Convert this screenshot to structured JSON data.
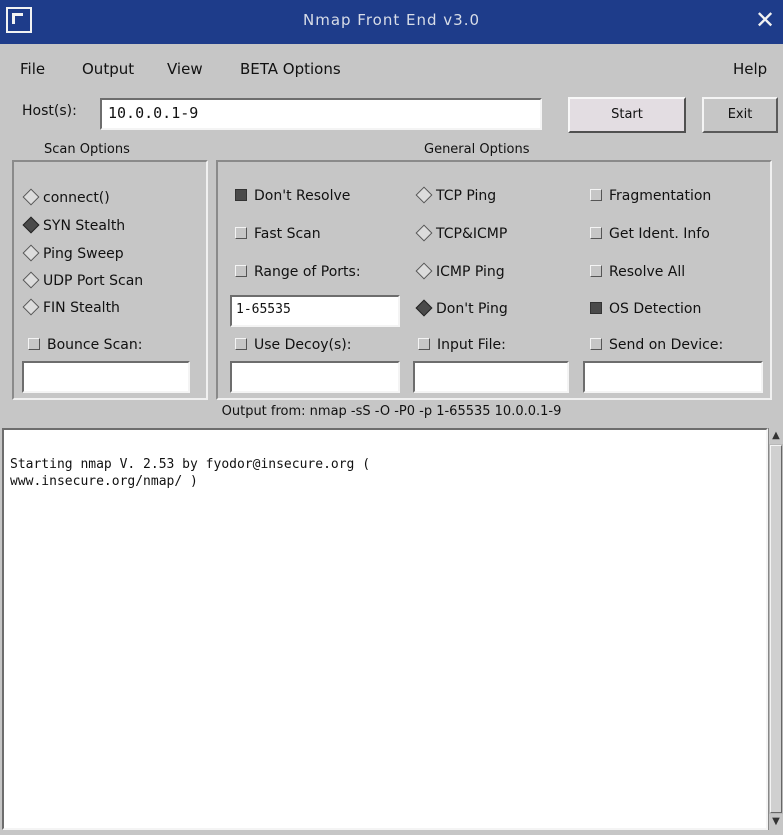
{
  "window": {
    "title": "Nmap Front End v3.0",
    "close_glyph": "✕"
  },
  "menubar": {
    "file": "File",
    "output": "Output",
    "view": "View",
    "beta": "BETA Options",
    "help": "Help"
  },
  "hosts": {
    "label": "Host(s):",
    "value": "10.0.0.1-9"
  },
  "buttons": {
    "start": "Start",
    "exit": "Exit"
  },
  "scan_options": {
    "title": "Scan Options",
    "connect": "connect()",
    "syn": "SYN Stealth",
    "ping_sweep": "Ping Sweep",
    "udp": "UDP Port Scan",
    "fin": "FIN Stealth",
    "bounce": "Bounce Scan:",
    "bounce_value": ""
  },
  "general_options": {
    "title": "General Options",
    "dont_resolve": "Don't Resolve",
    "fast_scan": "Fast Scan",
    "range_of_ports": "Range of Ports:",
    "range_value": "1-65535",
    "use_decoys": "Use Decoy(s):",
    "decoy_value": "",
    "tcp_ping": "TCP Ping",
    "tcp_icmp": "TCP&ICMP",
    "icmp_ping": "ICMP Ping",
    "dont_ping": "Don't Ping",
    "input_file": "Input File:",
    "input_value": "",
    "fragmentation": "Fragmentation",
    "get_ident": "Get Ident. Info",
    "resolve_all": "Resolve All",
    "os_detection": "OS Detection",
    "send_device": "Send on Device:",
    "device_value": ""
  },
  "status": {
    "command": "Output from: nmap -sS -O -P0 -p 1-65535 10.0.0.1-9"
  },
  "output": {
    "text": "Starting nmap V. 2.53 by fyodor@insecure.org (\nwww.insecure.org/nmap/ )"
  }
}
